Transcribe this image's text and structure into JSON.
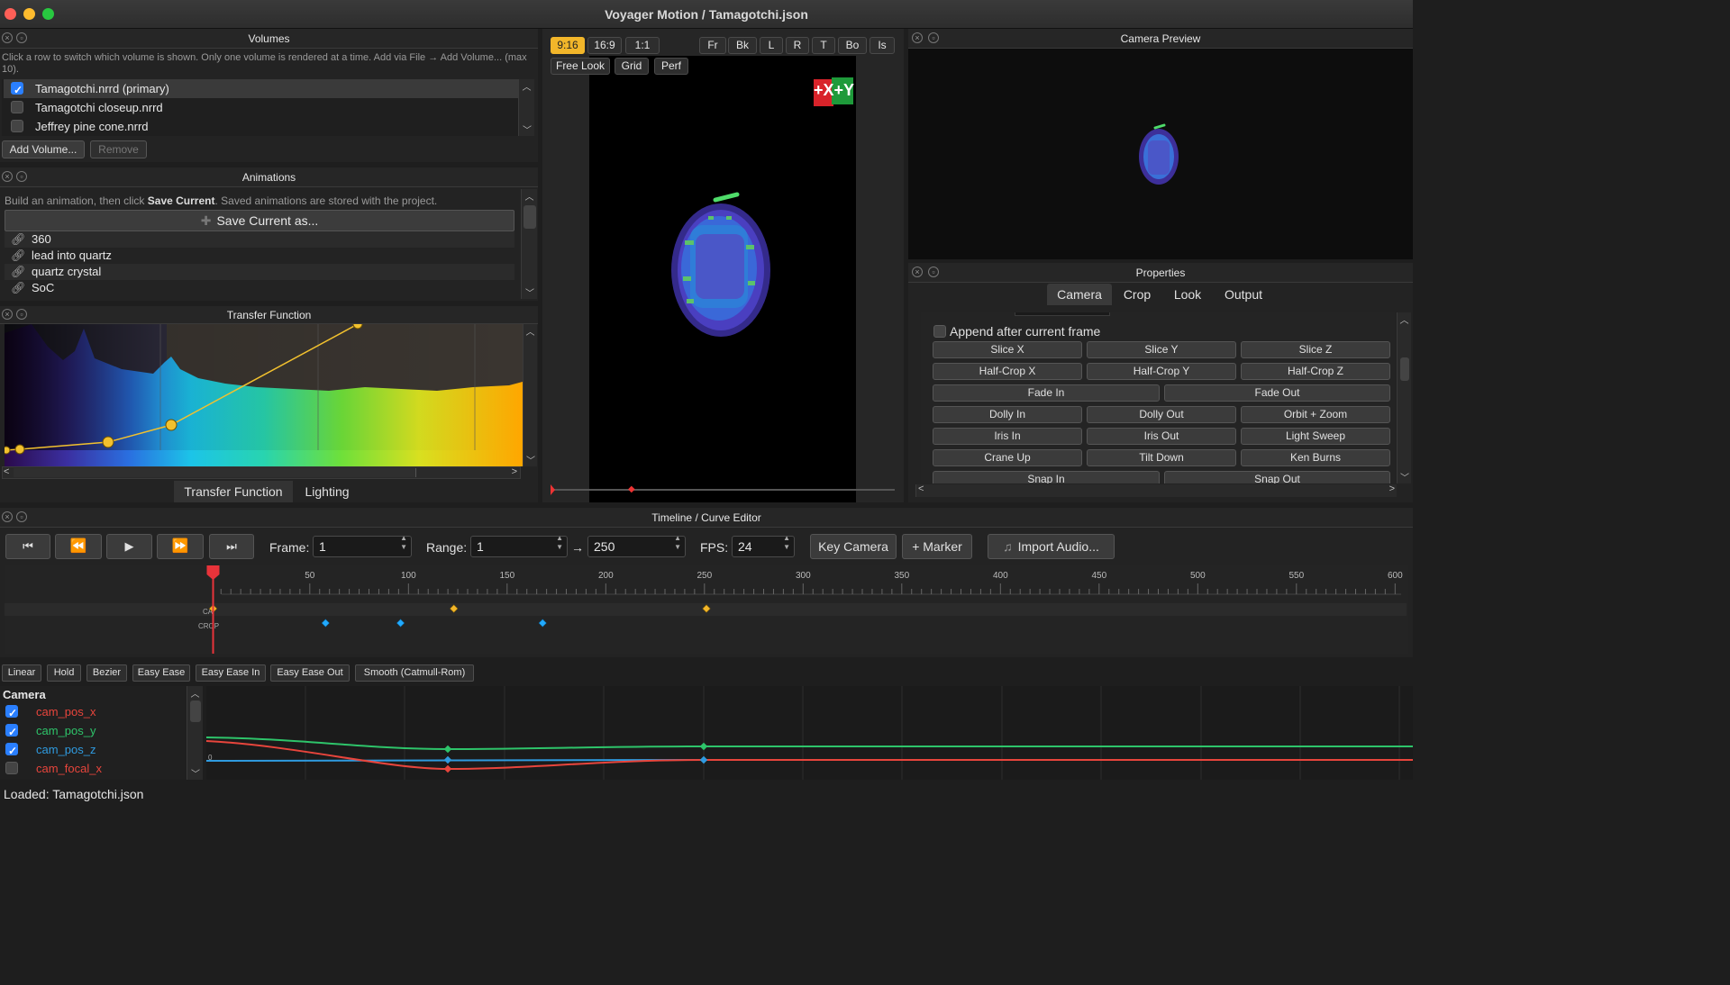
{
  "window": {
    "title": "Voyager Motion / Tamagotchi.json"
  },
  "volumes": {
    "title": "Volumes",
    "hint": "Click a row to switch which volume is shown.  Only one volume is rendered at a time.  Add via File → Add Volume... (max 10).",
    "items": [
      {
        "label": "Tamagotchi.nrrd (primary)",
        "checked": true
      },
      {
        "label": "Tamagotchi closeup.nrrd",
        "checked": false
      },
      {
        "label": "Jeffrey pine cone.nrrd",
        "checked": false
      }
    ],
    "add_label": "Add Volume...",
    "remove_label": "Remove"
  },
  "animations": {
    "title": "Animations",
    "hint_pre": "Build an animation, then click ",
    "hint_bold": "Save Current",
    "hint_post": ". Saved animations are stored with the project.",
    "save_label": "Save Current as...",
    "items": [
      "360",
      "lead into quartz",
      "quartz crystal",
      "SoC"
    ]
  },
  "transfer": {
    "title": "Transfer Function",
    "tabs": [
      "Transfer Function",
      "Lighting"
    ]
  },
  "viewport": {
    "aspect_buttons": [
      "9:16",
      "16:9",
      "1:1"
    ],
    "active_aspect": "9:16",
    "view_buttons": [
      "Fr",
      "Bk",
      "L",
      "R",
      "T",
      "Bo",
      "Is"
    ],
    "mode_buttons": [
      "Free Look",
      "Grid",
      "Perf"
    ],
    "gizmo_label": "+X+Y"
  },
  "camera_preview": {
    "title": "Camera Preview"
  },
  "properties": {
    "title": "Properties",
    "tabs": [
      "Camera",
      "Crop",
      "Look",
      "Output"
    ],
    "active_tab": "Camera",
    "append_label": "Append after current frame",
    "grid3": [
      [
        "Slice X",
        "Slice Y",
        "Slice Z"
      ],
      [
        "Half-Crop X",
        "Half-Crop Y",
        "Half-Crop Z"
      ]
    ],
    "grid2a": [
      "Fade In",
      "Fade Out"
    ],
    "grid3b": [
      [
        "Dolly In",
        "Dolly Out",
        "Orbit + Zoom"
      ],
      [
        "Iris In",
        "Iris Out",
        "Light Sweep"
      ],
      [
        "Crane Up",
        "Tilt Down",
        "Ken Burns"
      ]
    ],
    "grid2b": [
      "Snap In",
      "Snap Out"
    ]
  },
  "timeline": {
    "title": "Timeline / Curve Editor",
    "frame_label": "Frame:",
    "frame_value": "1",
    "range_label": "Range:",
    "range_start": "1",
    "range_arrow": "→",
    "range_end": "250",
    "fps_label": "FPS:",
    "fps_value": "24",
    "key_camera_label": "Key Camera",
    "marker_label": "+ Marker",
    "import_audio_label": "Import Audio...",
    "ruler_ticks": [
      "50",
      "100",
      "150",
      "200",
      "250",
      "300",
      "350",
      "400",
      "450",
      "500",
      "550",
      "600"
    ],
    "track_labels": [
      "CA",
      "CROP"
    ],
    "playhead_frame": 1,
    "camera_keys": [
      1,
      123,
      251
    ],
    "crop_keys": [
      58,
      96,
      168
    ]
  },
  "curve_editor": {
    "interp_buttons": [
      "Linear",
      "Hold",
      "Bezier",
      "Easy Ease",
      "Easy Ease In",
      "Easy Ease Out",
      "Smooth (Catmull-Rom)"
    ],
    "group": "Camera",
    "channels": [
      {
        "name": "cam_pos_x",
        "checked": true,
        "color": "#e8453c"
      },
      {
        "name": "cam_pos_y",
        "checked": true,
        "color": "#2ec46a"
      },
      {
        "name": "cam_pos_z",
        "checked": true,
        "color": "#2f9be0"
      },
      {
        "name": "cam_focal_x",
        "checked": false,
        "color": "#e8453c"
      }
    ],
    "zero_label": "0"
  },
  "status": {
    "text": "Loaded: Tamagotchi.json"
  }
}
